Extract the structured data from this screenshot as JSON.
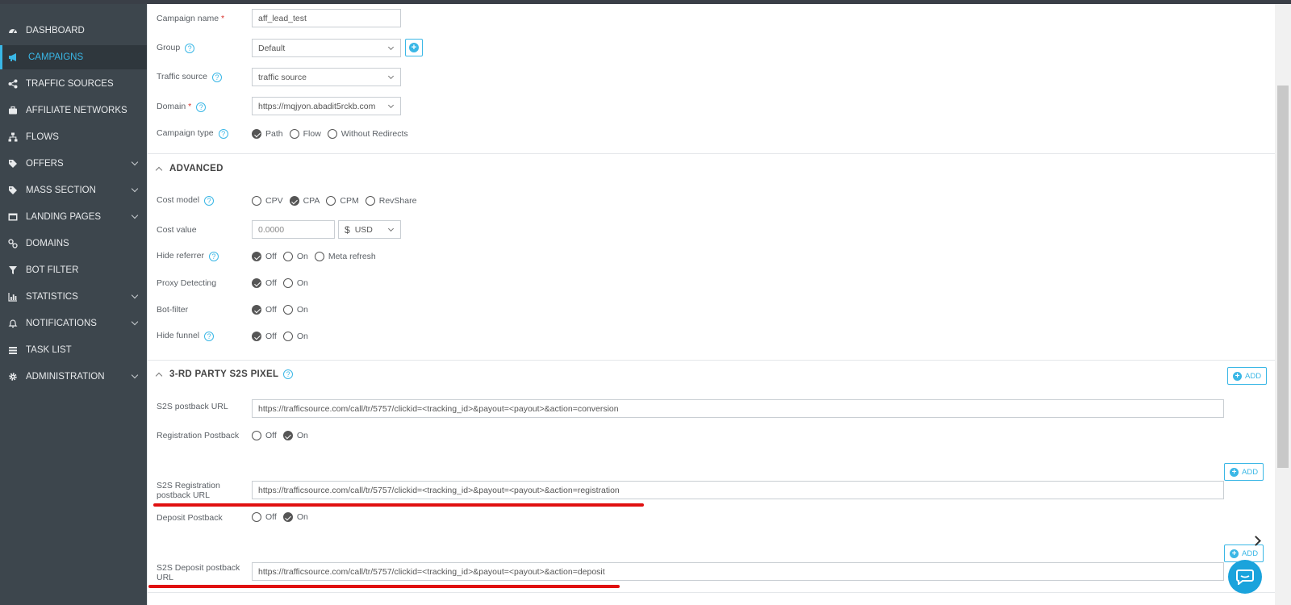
{
  "sidebar": {
    "items": [
      {
        "label": "DASHBOARD",
        "icon": "dashboard-icon",
        "active": false
      },
      {
        "label": "CAMPAIGNS",
        "icon": "megaphone-icon",
        "active": true
      },
      {
        "label": "TRAFFIC SOURCES",
        "icon": "share-icon",
        "active": false
      },
      {
        "label": "AFFILIATE NETWORKS",
        "icon": "briefcase-icon",
        "active": false
      },
      {
        "label": "FLOWS",
        "icon": "sitemap-icon",
        "active": false
      },
      {
        "label": "OFFERS",
        "icon": "tags-icon",
        "active": false,
        "expandable": true
      },
      {
        "label": "MASS SECTION",
        "icon": "tags-icon",
        "active": false,
        "expandable": true
      },
      {
        "label": "LANDING PAGES",
        "icon": "window-icon",
        "active": false,
        "expandable": true
      },
      {
        "label": "DOMAINS",
        "icon": "link-icon",
        "active": false
      },
      {
        "label": "BOT FILTER",
        "icon": "filter-icon",
        "active": false
      },
      {
        "label": "STATISTICS",
        "icon": "bar-chart-icon",
        "active": false,
        "expandable": true
      },
      {
        "label": "NOTIFICATIONS",
        "icon": "bell-icon",
        "active": false,
        "expandable": true
      },
      {
        "label": "TASK LIST",
        "icon": "list-icon",
        "active": false
      },
      {
        "label": "ADMINISTRATION",
        "icon": "gear-icon",
        "active": false,
        "expandable": true
      }
    ]
  },
  "form": {
    "campaign_name": {
      "label": "Campaign name",
      "required": "*",
      "value": "aff_lead_test"
    },
    "group": {
      "label": "Group",
      "value": "Default"
    },
    "traffic_source": {
      "label": "Traffic source",
      "value": "traffic source"
    },
    "domain": {
      "label": "Domain",
      "required": "*",
      "value": "https://mqjyon.abadit5rckb.com"
    },
    "campaign_type": {
      "label": "Campaign type",
      "options": [
        "Path",
        "Flow",
        "Without Redirects"
      ],
      "selected": "Path"
    }
  },
  "advanced": {
    "title": "ADVANCED",
    "cost_model": {
      "label": "Cost model",
      "options": [
        "CPV",
        "CPA",
        "CPM",
        "RevShare"
      ],
      "selected": "CPA"
    },
    "cost_value": {
      "label": "Cost value",
      "placeholder": "0.0000",
      "currency_symbol": "$",
      "currency": "USD"
    },
    "hide_referrer": {
      "label": "Hide referrer",
      "options": [
        "Off",
        "On",
        "Meta refresh"
      ],
      "selected": "Off"
    },
    "proxy_detecting": {
      "label": "Proxy Detecting",
      "options": [
        "Off",
        "On"
      ],
      "selected": "Off"
    },
    "bot_filter": {
      "label": "Bot-filter",
      "options": [
        "Off",
        "On"
      ],
      "selected": "Off"
    },
    "hide_funnel": {
      "label": "Hide funnel",
      "options": [
        "Off",
        "On"
      ],
      "selected": "Off"
    }
  },
  "s2s": {
    "title": "3-RD PARTY S2S PIXEL",
    "add_label": "ADD",
    "postback_url": {
      "label": "S2S postback URL",
      "value": "https://trafficsource.com/call/tr/5757/clickid=<tracking_id>&payout=<payout>&action=conversion"
    },
    "registration_postback": {
      "label": "Registration Postback",
      "options": [
        "Off",
        "On"
      ],
      "selected": "On"
    },
    "registration_url": {
      "label_line1": "S2S Registration",
      "label_line2": "postback URL",
      "value": "https://trafficsource.com/call/tr/5757/clickid=<tracking_id>&payout=<payout>&action=registration"
    },
    "deposit_postback": {
      "label": "Deposit Postback",
      "options": [
        "Off",
        "On"
      ],
      "selected": "On"
    },
    "deposit_url": {
      "label_line1": "S2S Deposit postback",
      "label_line2": "URL",
      "value": "https://trafficsource.com/call/tr/5757/clickid=<tracking_id>&payout=<payout>&action=deposit"
    }
  },
  "colors": {
    "accent": "#3ab7e6",
    "sidebar_bg": "#3d464d",
    "highlight": "#e01010",
    "chat": "#1aa3dc"
  }
}
